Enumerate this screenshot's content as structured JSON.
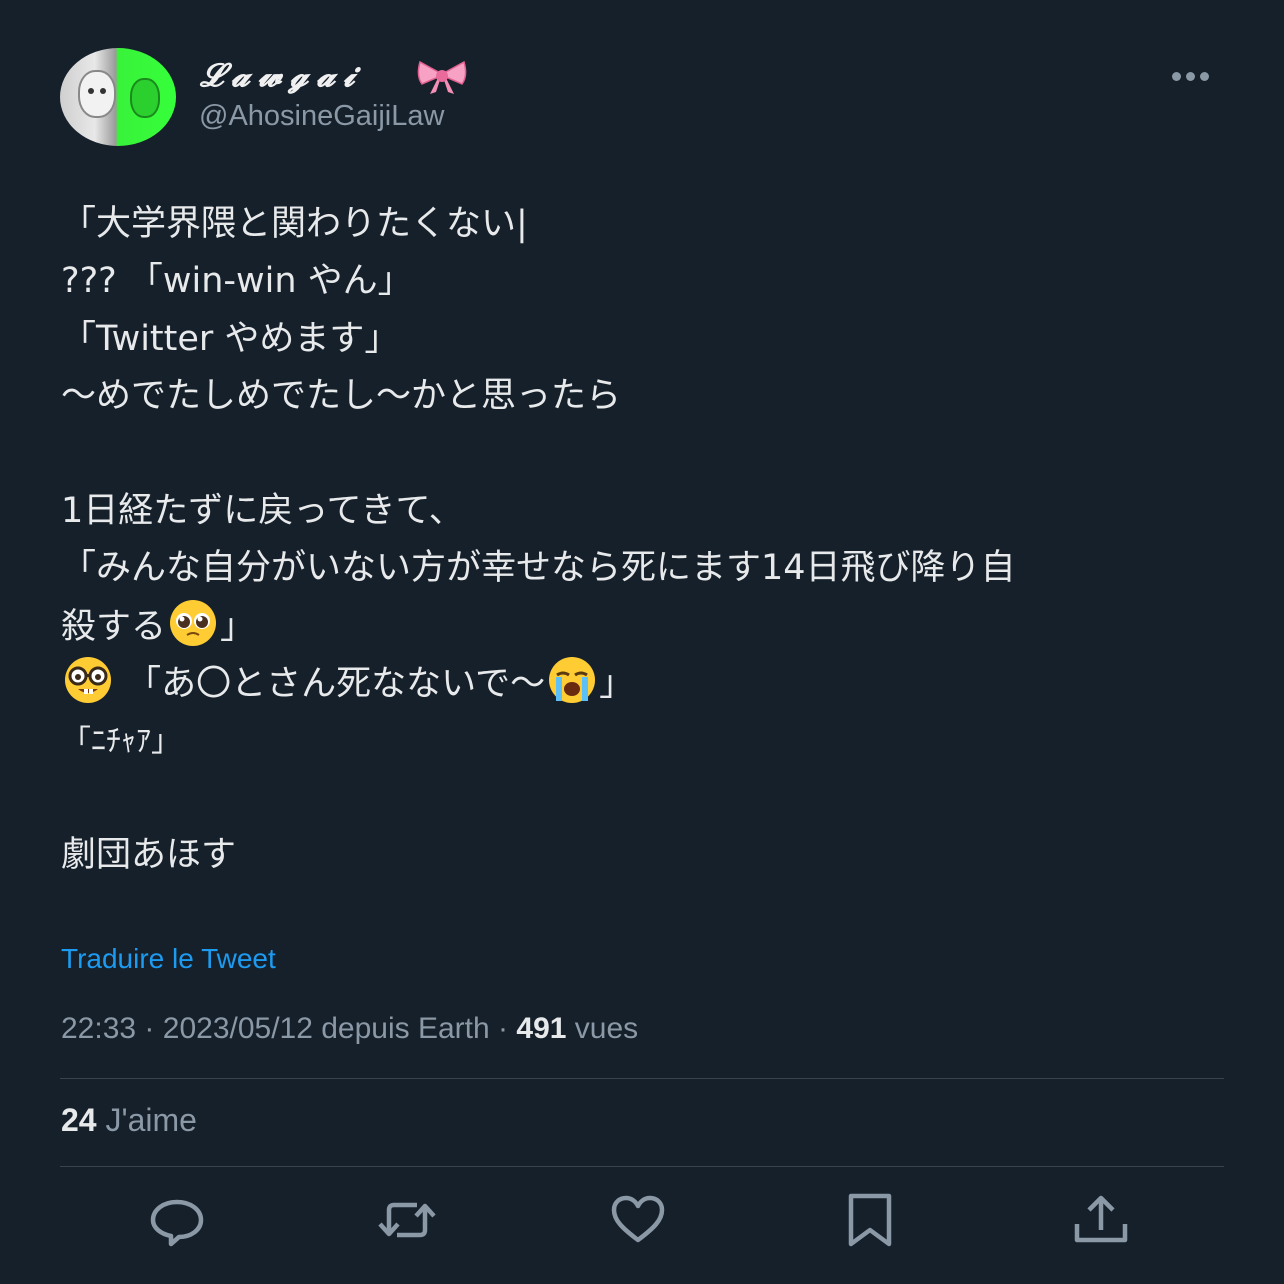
{
  "author": {
    "display_name": "𝓛𝓪𝔀𝓰𝓪𝓲",
    "display_name_emoji": "ribbon-emoji",
    "handle": "@AhosineGaijiLaw"
  },
  "tweet": {
    "lines": [
      "「大学界隈と関わりたくない|",
      "??? 「win-win やん」",
      "「Twitter やめます」",
      "～めでたしめでたし～かと思ったら",
      "",
      "1日経たずに戻ってきて、",
      "「みんな自分がいない方が幸せなら死にます14日飛び降り自",
      "殺する",
      "「あ〇とさん死なないで〜",
      "「ﾆﾁｬｱ」",
      "",
      "劇団あほす"
    ],
    "line8_tail": "」",
    "line9_tail": "」",
    "emojis": {
      "pleading": "pleading-face-emoji",
      "nerd": "nerd-face-emoji",
      "crying": "loudly-crying-face-emoji"
    }
  },
  "translate_label": "Traduire le Tweet",
  "meta": {
    "time": "22:33",
    "separator": "·",
    "date_source": "2023/05/12 depuis Earth",
    "views_count": "491",
    "views_label": "vues"
  },
  "stats": {
    "likes_count": "24",
    "likes_label": "J'aime"
  },
  "actions": [
    "reply-icon",
    "retweet-icon",
    "like-icon",
    "bookmark-icon",
    "share-icon"
  ],
  "colors": {
    "background": "#15202b",
    "text": "#e7e9ea",
    "secondary": "#8b98a5",
    "link": "#1d9bf0",
    "divider": "#38444d"
  }
}
